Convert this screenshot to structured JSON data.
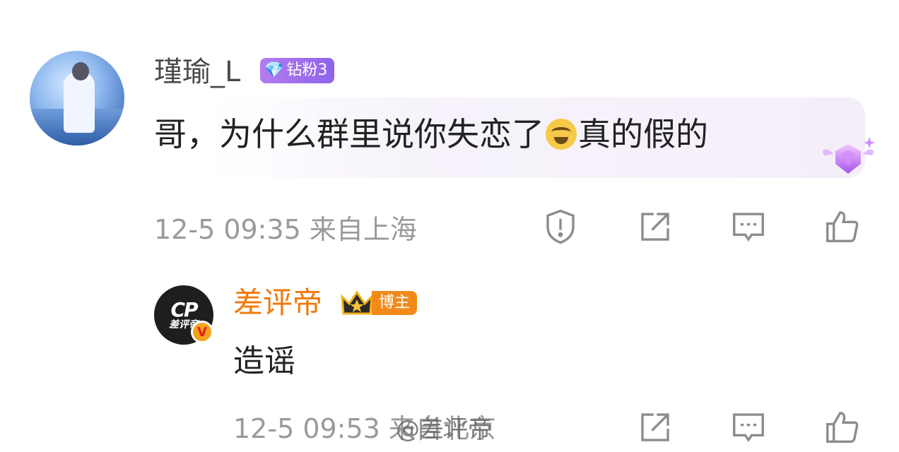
{
  "comment1": {
    "username": "瑾瑜_L",
    "fan_badge": "钻粉3",
    "text_before_emoji": "哥，为什么群里说你失恋了",
    "emoji": "laugh-cry-emoji",
    "text_after_emoji": "真的假的",
    "time": "12-5 09:35",
    "location": "来自上海"
  },
  "comment2": {
    "username": "差评帝",
    "role_badge": "博主",
    "avatar_text": "差评帝",
    "avatar_logo": "CP",
    "verify_mark": "V",
    "text": "造谣",
    "time": "12-5 09:53",
    "location": "来自北京"
  },
  "watermark": "@差评帝",
  "colors": {
    "username_gray": "#4a4a4a",
    "blogger_orange": "#f07a0c",
    "fan_badge_purple": "#8e63ea",
    "meta_gray": "#9a9a9a",
    "icon_gray": "#8c8c8c"
  }
}
